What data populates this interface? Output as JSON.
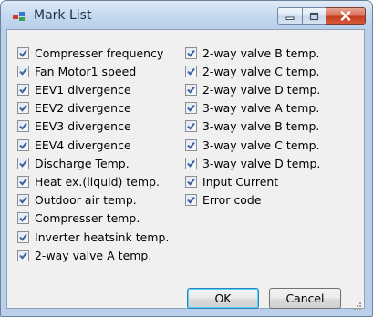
{
  "window": {
    "title": "Mark List",
    "icon": "app-icon",
    "controls": [
      "minimize-icon",
      "maximize-icon",
      "close-icon"
    ]
  },
  "left_items": [
    {
      "label": "Compresser frequency",
      "checked": true
    },
    {
      "label": "Fan Motor1 speed",
      "checked": true
    },
    {
      "label": "EEV1 divergence",
      "checked": true
    },
    {
      "label": "EEV2 divergence",
      "checked": true
    },
    {
      "label": "EEV3 divergence",
      "checked": true
    },
    {
      "label": "EEV4 divergence",
      "checked": true
    },
    {
      "label": "Discharge Temp.",
      "checked": true
    },
    {
      "label": "Heat ex.(liquid) temp.",
      "checked": true
    },
    {
      "label": "Outdoor air temp.",
      "checked": true
    },
    {
      "label": "Compresser temp.",
      "checked": true
    },
    {
      "label": "Inverter heatsink temp.",
      "checked": true
    },
    {
      "label": "2-way valve A temp.",
      "checked": true
    }
  ],
  "right_items": [
    {
      "label": "2-way valve B temp.",
      "checked": true
    },
    {
      "label": "2-way valve C temp.",
      "checked": true
    },
    {
      "label": "2-way valve D temp.",
      "checked": true
    },
    {
      "label": "3-way valve A temp.",
      "checked": true
    },
    {
      "label": "3-way valve B temp.",
      "checked": true
    },
    {
      "label": "3-way valve C temp.",
      "checked": true
    },
    {
      "label": "3-way valve D temp.",
      "checked": true
    },
    {
      "label": "Input Current",
      "checked": true
    },
    {
      "label": "Error code",
      "checked": true
    }
  ],
  "buttons": {
    "ok": "OK",
    "cancel": "Cancel"
  },
  "colors": {
    "check": "#3f5f9a",
    "focus_border": "#3c7fb1",
    "close": "#c33d1f"
  }
}
